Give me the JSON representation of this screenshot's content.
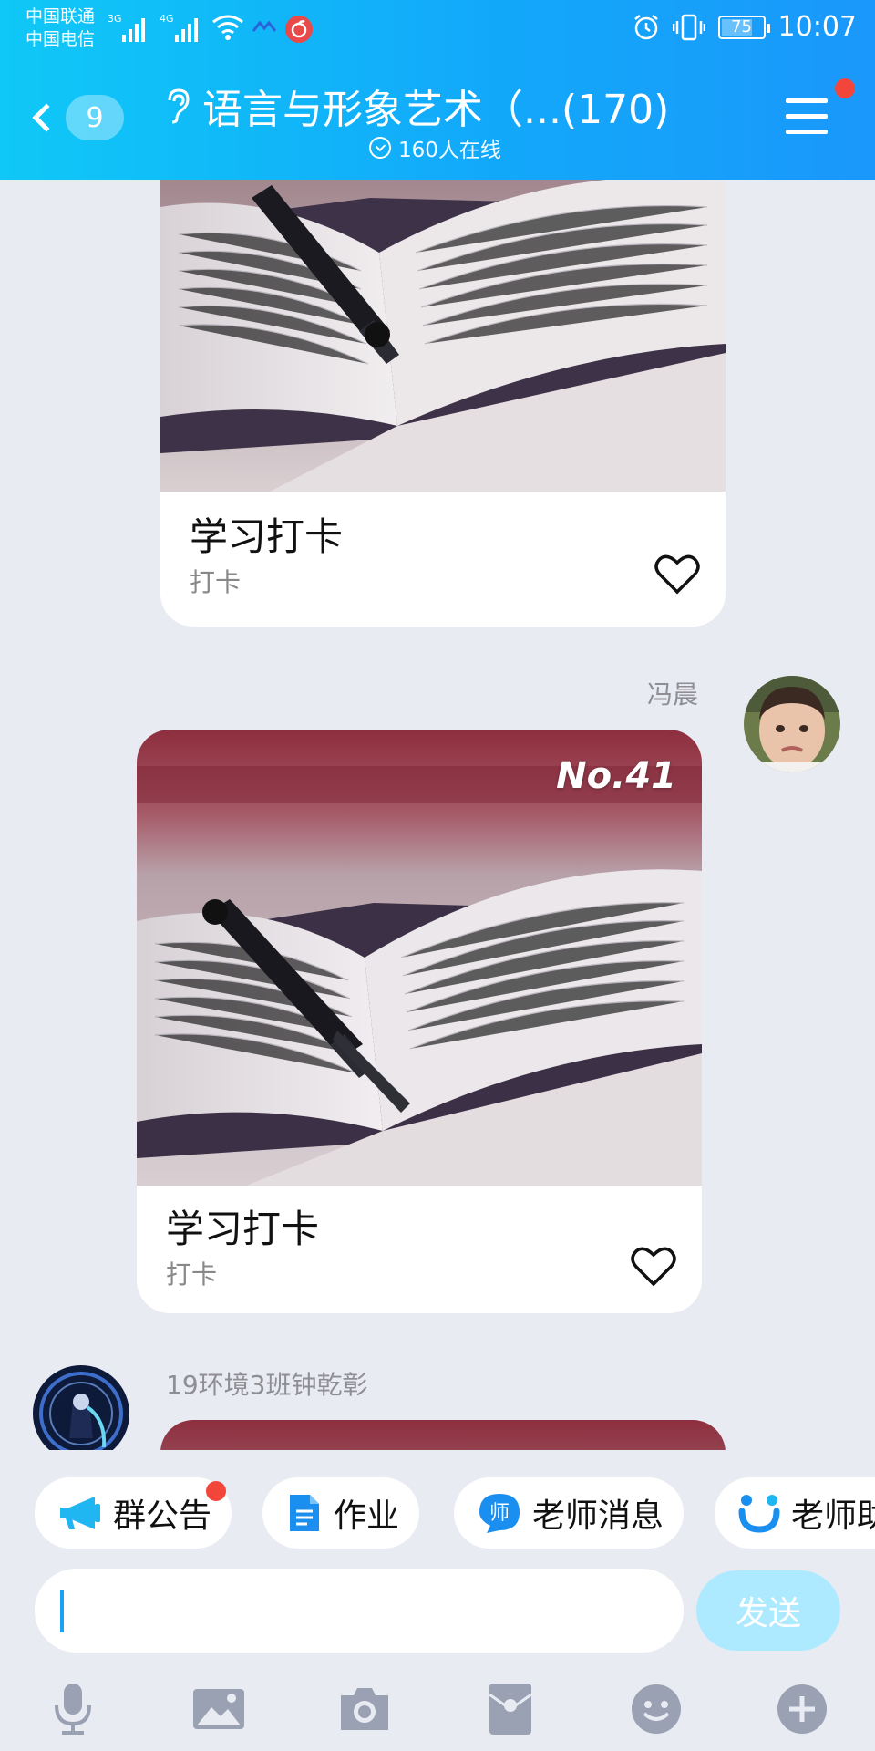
{
  "status_bar": {
    "carrier_1": "中国联通",
    "carrier_2": "中国电信",
    "net_1": "3G",
    "net_2": "4G",
    "battery": "75",
    "time": "10:07"
  },
  "header": {
    "unread_count": "9",
    "title": "语言与形象艺术（...(170)",
    "online": "160人在线"
  },
  "messages": [
    {
      "card_title": "学习打卡",
      "card_subtitle": "打卡"
    },
    {
      "sender": "冯晨",
      "badge": "No.41",
      "card_title": "学习打卡",
      "card_subtitle": "打卡"
    },
    {
      "sender": "19环境3班钟乾彰"
    }
  ],
  "shortcuts": [
    {
      "label": "群公告",
      "icon": "megaphone-icon",
      "badge": true
    },
    {
      "label": "作业",
      "icon": "document-icon"
    },
    {
      "label": "老师消息",
      "icon": "teacher-icon"
    },
    {
      "label": "老师助",
      "icon": "smile-u-icon"
    }
  ],
  "composer": {
    "send_label": "发送",
    "tools": [
      "microphone-icon",
      "image-icon",
      "camera-icon",
      "red-packet-icon",
      "emoji-icon",
      "plus-icon"
    ]
  },
  "colors": {
    "header_start": "#0fc8f7",
    "header_end": "#1a98fb",
    "background": "#e9ebf2",
    "badge_red": "#f2463b",
    "send_button": "#aeeaff"
  }
}
